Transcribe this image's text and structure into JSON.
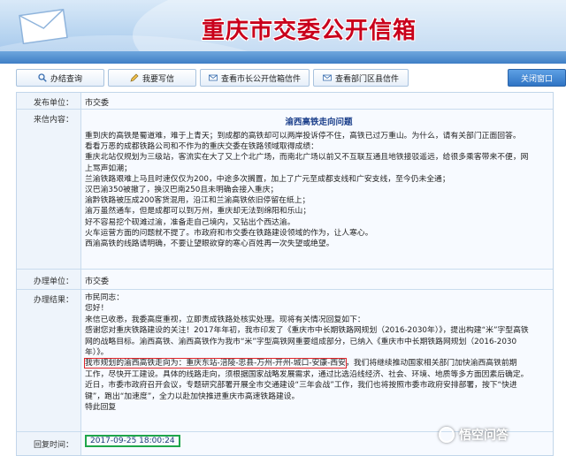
{
  "header": {
    "title": "重庆市交委公开信箱"
  },
  "toolbar": {
    "buttons": [
      {
        "label": "办结查询",
        "icon": "magnifier-icon"
      },
      {
        "label": "我要写信",
        "icon": "pencil-icon"
      },
      {
        "label": "查看市长公开信箱信件",
        "icon": "envelope-icon"
      },
      {
        "label": "查看部门区县信件",
        "icon": "envelope-icon"
      }
    ],
    "close_label": "关闭窗口"
  },
  "letter": {
    "sender_label": "发布单位：",
    "sender_value": "市交委",
    "content_label": "来信内容：",
    "title": "渝西高铁走向问题",
    "lines": [
      "重到庆的高铁是蜀道难，难于上青天；到成都的高铁却可以两岸投诉停不住，高铁已过万重山。为什么，请有关部门正面回答。",
      "看看万恶的成都铁路公司和不作为的重庆交委在铁路领域取得成绩：",
      "重庆北站仅规划为三级站，客流实在大了又上个北广场，而南北广场以前又不互联互通且地铁接驳遥远，给很多乘客带来不便，网",
      "上骂声如潮；",
      "兰渝铁路艰难上马且时速仅仅为200，中途多次搁置，加上了广元至成都支线和广安支线，至今仍未全通；",
      "汉巴渝350被撤了，换汉巴南250且未明确会接入重庆；",
      "渝黔铁路被压成200客货混用，沿江和兰渝高铁依旧停留在纸上；",
      "渝万虽然通车，但是成都可以到万州，重庆却无法到绵阳和乐山；",
      "好不容易挖个砚滩过渝，准备走自己境内，又钻出个西达渝。",
      "火车运营方面的问题就不提了。市政府和市交委在铁路建设领域的作为，让人寒心。",
      "西渝高铁的线路请明确，不要让望眼欲穿的寒心百姓再一次失望或绝望。"
    ],
    "handler_label": "办理单位：",
    "handler_value": "市交委",
    "result_label": "办理结果：",
    "reply_lines": [
      "市民同志：",
      "您好！",
      "来信已收悉，我委高度重视，立即责成铁路处核实处理。现将有关情况回复如下：",
      "感谢您对重庆铁路建设的关注！2017年年初，我市印发了《重庆市中长期铁路网规划（2016-2030年）》，提出构建“米”字型高铁",
      "网的战略目标。渝西高铁、渝西高铁作为我市“米”字型高铁网重要组成部分，已纳入《重庆市中长期铁路网规划（2016-2030",
      "年）》。",
      "工作，尽快开工建设。具体的线路走向，须根据国家战略发展需求，通过比选沿线经济、社会、环境、地质等多方面因素后确定。",
      "近日，市委市政府召开会议，专题研究部署开展全市交通建设“三年会战”工作，我们也将按照市委市政府安排部署，按下“快进",
      "键”，跑出“加速度”，全力以赴加快推进重庆市高速铁路建设。",
      "特此回复"
    ],
    "reply_highlight_line": "我市规划的渝西高铁走向为：重庆东站-涪陵-忠县-万州-开州-城口-安康-西安",
    "reply_highlight_rest": "，我们将继续推动国家相关部门加快渝西高铁前期",
    "time_label": "回复时间：",
    "time_value": "2017-09-25 18:00:24"
  },
  "watermark": {
    "text": "悟空问答"
  },
  "colors": {
    "title_red": "#c9001b",
    "highlight_red": "#e0262b",
    "highlight_green": "#1fa64a",
    "frame_blue": "#c2d6ea"
  }
}
